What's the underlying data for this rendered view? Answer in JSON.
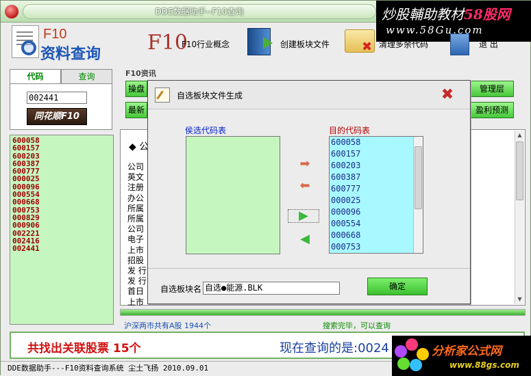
{
  "window": {
    "title": "DDE数据助手--F10查询"
  },
  "watermark_top": {
    "line1_prefix": "炒股輔助教材",
    "line1_brand": "58股网",
    "line2": "www.58Gu.com"
  },
  "logo": {
    "line1": "F10",
    "line2": "资料查询"
  },
  "toolbar": {
    "f10_mark": "F10",
    "industry_label": "F10行业概念",
    "create_block_label": "创建板块文件",
    "cleanup_label": "清理多余代码",
    "exit_label": "退    出"
  },
  "left_tabs": {
    "code_tab": "代码",
    "query_tab": "查询"
  },
  "code_input": {
    "value": "002441"
  },
  "ths_button": {
    "label": "同花顺F10"
  },
  "code_list": [
    "600058",
    "600157",
    "600203",
    "600387",
    "600777",
    "000025",
    "000096",
    "000554",
    "000668",
    "000753",
    "000829",
    "000906",
    "002221",
    "002416",
    "002441"
  ],
  "f10_group": {
    "label": "F10资讯",
    "btn_operation": "操盘",
    "btn_latest": "最新",
    "btn_management": "管理层",
    "btn_profit_forecast": "盈利预测"
  },
  "info_panel": {
    "heading": "◆ 公",
    "rows": [
      "公司",
      "英文",
      "注册",
      "办公",
      "所属",
      "所属",
      "公司",
      "电子",
      "上市",
      "招股",
      "发 行",
      "发 行",
      "首日",
      "上市"
    ]
  },
  "progress": {
    "value_pct": 100
  },
  "status": {
    "left": "沪深两市共有A股 1944个",
    "right": "搜索完毕，可以查询"
  },
  "result": {
    "count_text": "共找出关联股票  15个",
    "query_text": "现在查询的是:0024"
  },
  "status_line": "DDE数据助手---F10资料查询系统    尘土飞扬 2010.09.01",
  "watermark_bottom": {
    "brand": "分析家公式网",
    "url": "www.88gs.com"
  },
  "dialog": {
    "title": "自选板块文件生成",
    "candidate_label": "侯选代码表",
    "target_label": "目的代码表",
    "target_codes": [
      "600058",
      "600157",
      "600203",
      "600387",
      "600777",
      "000025",
      "000096",
      "000554",
      "000668",
      "000753"
    ],
    "blockname_label": "自选板块名",
    "blockname_value": "自选●能源.BLK",
    "confirm_label": "确定"
  },
  "colors": {
    "accent_green": "#46c83a",
    "code_red": "#a00000",
    "list_green_bg": "#c6f6c0",
    "list_cyan_bg": "#a8f8ff"
  }
}
